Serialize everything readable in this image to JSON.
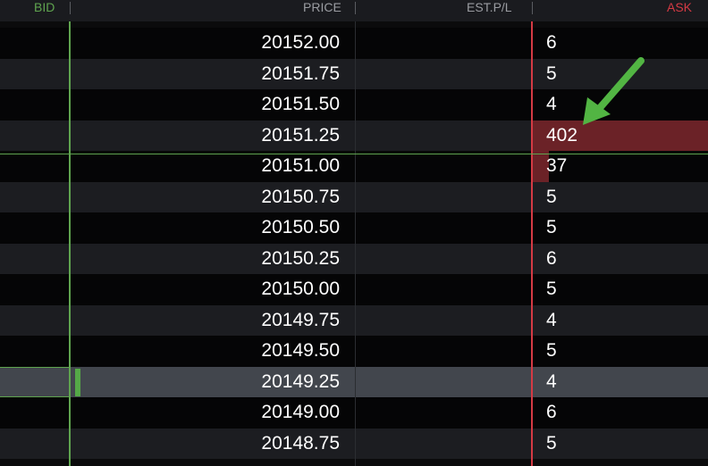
{
  "header": {
    "bid": "BID",
    "price": "PRICE",
    "est_pl": "EST.P/L",
    "ask": "ASK"
  },
  "colors": {
    "bid_accent": "#5fa44f",
    "ask_accent": "#d43a44",
    "ask_bar": "#6b2227",
    "header_bg": "#1a1b1f",
    "row_alt": "#1c1d21",
    "row_dark": "#050506",
    "selected_row": "#42464d",
    "annotation_arrow": "#52b543"
  },
  "annotation": {
    "icon": "green-arrow-icon",
    "target": "ask-402"
  },
  "rows": [
    {
      "price": "20152.00",
      "ask": "6",
      "ask_fill": 0
    },
    {
      "price": "20151.75",
      "ask": "5",
      "ask_fill": 0
    },
    {
      "price": "20151.50",
      "ask": "4",
      "ask_fill": 0
    },
    {
      "price": "20151.25",
      "ask": "402",
      "ask_fill": 1.0
    },
    {
      "price": "20151.00",
      "ask": "37",
      "ask_fill": 0.092
    },
    {
      "price": "20150.75",
      "ask": "5",
      "ask_fill": 0
    },
    {
      "price": "20150.50",
      "ask": "5",
      "ask_fill": 0
    },
    {
      "price": "20150.25",
      "ask": "6",
      "ask_fill": 0
    },
    {
      "price": "20150.00",
      "ask": "5",
      "ask_fill": 0
    },
    {
      "price": "20149.75",
      "ask": "4",
      "ask_fill": 0
    },
    {
      "price": "20149.50",
      "ask": "5",
      "ask_fill": 0
    },
    {
      "price": "20149.25",
      "ask": "4",
      "ask_fill": 0,
      "selected": true,
      "bid_fill": 0.012
    },
    {
      "price": "20149.00",
      "ask": "6",
      "ask_fill": 0
    },
    {
      "price": "20148.75",
      "ask": "5",
      "ask_fill": 0
    }
  ]
}
